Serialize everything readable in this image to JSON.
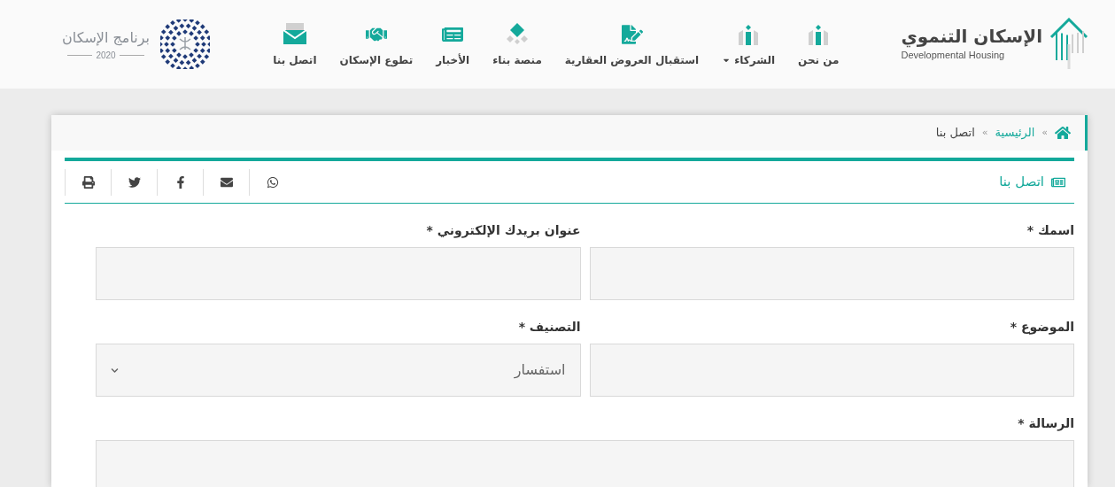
{
  "header": {
    "logo": {
      "title": "الإسكان التنموي",
      "subtitle": "Developmental Housing"
    },
    "nav": [
      {
        "label": "من نحن",
        "dropdown": false
      },
      {
        "label": "الشركاء",
        "dropdown": true
      },
      {
        "label": "استقبال العروض العقارية",
        "dropdown": false
      },
      {
        "label": "منصة بناء",
        "dropdown": false
      },
      {
        "label": "الأخبار",
        "dropdown": false
      },
      {
        "label": "تطوع الإسكان",
        "dropdown": false
      },
      {
        "label": "اتصل بنا",
        "dropdown": false
      }
    ],
    "program": {
      "title": "برنامج الإسكان",
      "year": "2020"
    }
  },
  "breadcrumb_separator": "»",
  "breadcrumb": [
    {
      "label": "الرئيسية",
      "link": true
    },
    {
      "label": "اتصل بنا",
      "link": false
    }
  ],
  "section_title": "اتصل بنا",
  "fields": [
    {
      "kind": "text",
      "label": "اسمك *"
    },
    {
      "kind": "text",
      "label": "عنوان بريدك الإلكتروني *"
    },
    {
      "kind": "text",
      "label": "الموضوع *"
    },
    {
      "kind": "select",
      "label": "التصنيف *",
      "value": "استفسار"
    },
    {
      "kind": "textarea",
      "label": "الرسالة *"
    }
  ]
}
